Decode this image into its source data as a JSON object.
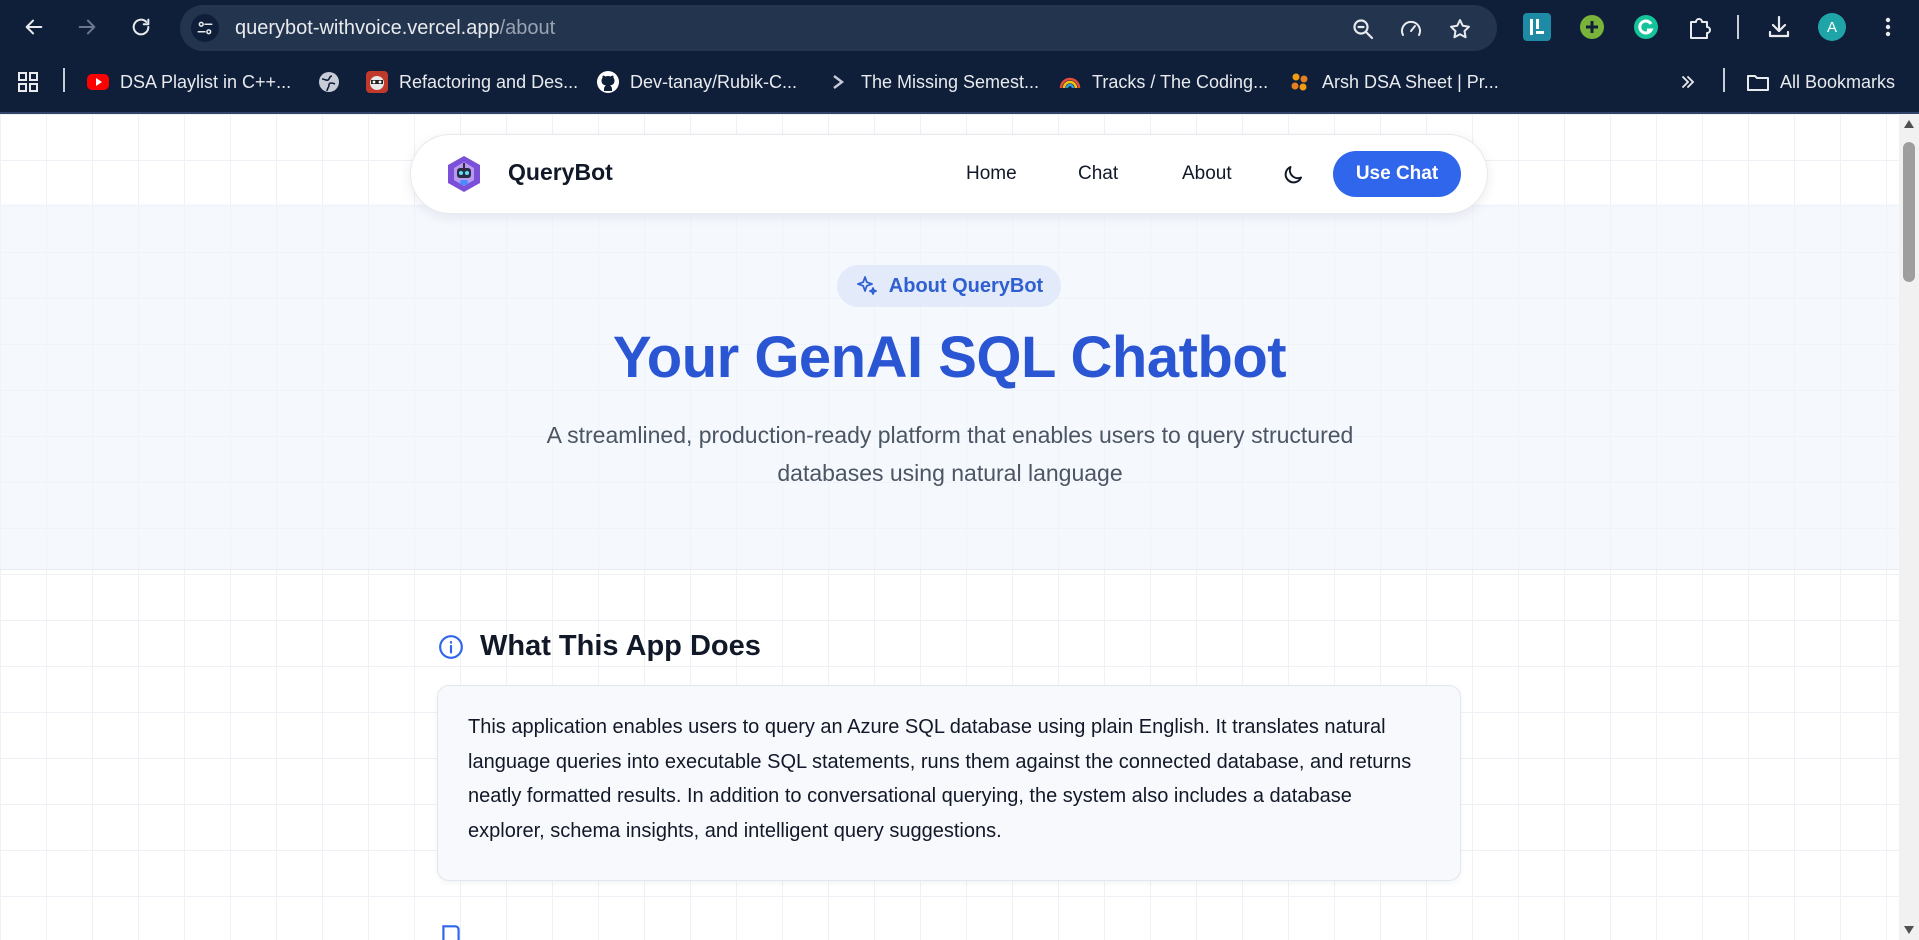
{
  "browser": {
    "url_host": "querybot-withvoice.vercel.app",
    "url_path": "/about",
    "profile_initial": "A",
    "bookmarks": [
      {
        "label": "DSA Playlist in C++...",
        "icon": "youtube-icon"
      },
      {
        "label": "",
        "icon": "globe-icon"
      },
      {
        "label": "Refactoring and Des...",
        "icon": "raccoon-icon"
      },
      {
        "label": "Dev-tanay/Rubik-C...",
        "icon": "github-icon"
      },
      {
        "label": "The Missing Semest...",
        "icon": "terminal-icon"
      },
      {
        "label": "Tracks / The Coding...",
        "icon": "rainbow-icon"
      },
      {
        "label": "Arsh DSA Sheet | Pr...",
        "icon": "dots-icon"
      }
    ],
    "all_bookmarks_label": "All Bookmarks"
  },
  "nav": {
    "brand": "QueryBot",
    "links": [
      "Home",
      "Chat",
      "About"
    ],
    "cta": "Use Chat"
  },
  "hero": {
    "badge": "About QueryBot",
    "title": "Your GenAI SQL Chatbot",
    "subtitle_line1": "A streamlined, production-ready platform that enables users to query structured",
    "subtitle_line2": "databases using natural language"
  },
  "section": {
    "title": "What This App Does",
    "body": "This application enables users to query an Azure SQL database using plain English. It translates natural language queries into executable SQL statements, runs them against the connected database, and returns neatly formatted results. In addition to conversational querying, the system also includes a database explorer, schema insights, and intelligent query suggestions."
  },
  "colors": {
    "chrome": "#0f1f3a",
    "accent": "#2f66ec",
    "title": "#2a55d3"
  }
}
